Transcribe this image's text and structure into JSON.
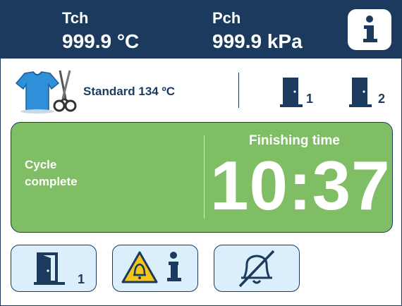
{
  "header": {
    "chamber_temp_label": "Tch",
    "chamber_temp_value": "999.9 °C",
    "chamber_pressure_label": "Pch",
    "chamber_pressure_value": "999.9 kPa",
    "info_icon": "info-icon"
  },
  "program": {
    "icon": "textile-scissors-icon",
    "label": "Standard 134 ºC",
    "door1_number": "1",
    "door2_number": "2",
    "door_icon": "door-closed-icon"
  },
  "status": {
    "message_line1": "Cycle",
    "message_line2": "complete",
    "finishing_label": "Finishing time",
    "finishing_time": "10:37"
  },
  "buttons": {
    "open_door_icon": "door-open-icon",
    "open_door_number": "1",
    "alarm_info_icon": "alarm-warning-info-icon",
    "mute_icon": "bell-muted-icon"
  },
  "colors": {
    "header_bg": "#1c3a5e",
    "status_bg": "#7fbe65",
    "button_bg": "#dbeefb",
    "warning": "#f5c518"
  }
}
